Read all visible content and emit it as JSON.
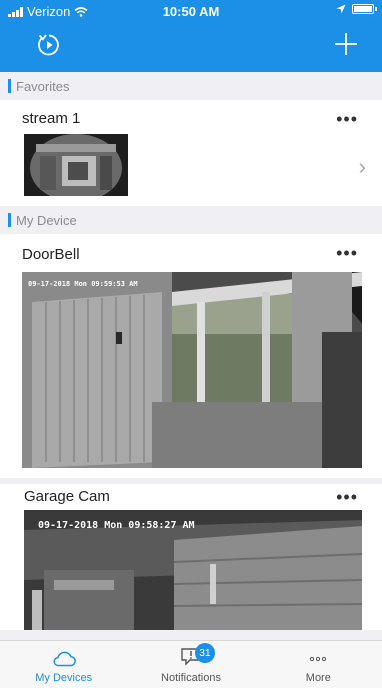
{
  "status_bar": {
    "carrier": "Verizon",
    "time": "10:50 AM"
  },
  "nav": {
    "left_icon": "refresh-icon",
    "right_icon": "plus-icon"
  },
  "sections": {
    "favorites": {
      "title": "Favorites",
      "items": [
        {
          "name": "stream 1",
          "more": "•••"
        }
      ]
    },
    "my_device": {
      "title": "My Device",
      "items": [
        {
          "name": "DoorBell",
          "more": "•••",
          "timestamp": "09-17-2018 Mon 09:59:53 AM"
        },
        {
          "name": "Garage Cam",
          "more": "•••",
          "timestamp": "09-17-2018 Mon 09:58:27 AM"
        }
      ]
    }
  },
  "tabbar": {
    "tabs": [
      {
        "label": "My Devices",
        "icon": "cloud-icon",
        "active": true
      },
      {
        "label": "Notifications",
        "icon": "chat-bubble-icon",
        "badge": "31"
      },
      {
        "label": "More",
        "icon": "more-dots-icon"
      }
    ]
  },
  "colors": {
    "accent": "#1c8fe6",
    "background": "#efeff4"
  }
}
